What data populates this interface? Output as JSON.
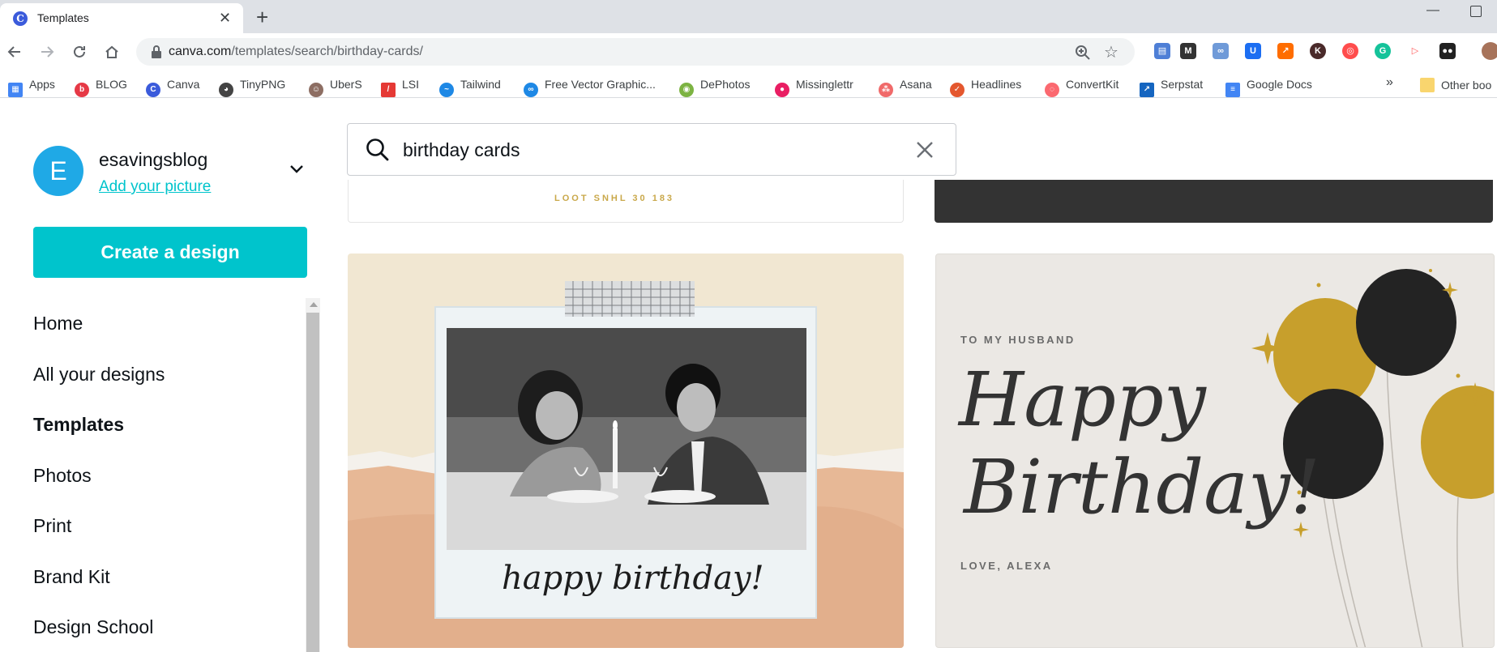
{
  "browser": {
    "tab_title": "Templates",
    "tab_favicon_letter": "C",
    "url_host": "canva.com",
    "url_path": "/templates/search/birthday-cards/",
    "icons": [
      "back-icon",
      "forward-icon",
      "reload-icon",
      "home-icon",
      "lock-icon",
      "zoom-icon",
      "star-icon"
    ]
  },
  "bookmarks": {
    "items": [
      {
        "label": "Apps",
        "color": "#ea4335"
      },
      {
        "label": "BLOG",
        "color": "#e63946"
      },
      {
        "label": "Canva",
        "color": "#3b5bdb"
      },
      {
        "label": "TinyPNG",
        "color": "#444444"
      },
      {
        "label": "UberS",
        "color": "#8d6e63"
      },
      {
        "label": "LSI",
        "color": "#e53935"
      },
      {
        "label": "Tailwind",
        "color": "#1e88e5"
      },
      {
        "label": "Free Vector Graphic...",
        "color": "#1e88e5"
      },
      {
        "label": "DePhotos",
        "color": "#7cb342"
      },
      {
        "label": "Missinglettr",
        "color": "#e91e63"
      },
      {
        "label": "Asana",
        "color": "#f06a6a"
      },
      {
        "label": "Headlines",
        "color": "#e4572e"
      },
      {
        "label": "ConvertKit",
        "color": "#fb6970"
      },
      {
        "label": "Serpstat",
        "color": "#1565c0"
      },
      {
        "label": "Google Docs",
        "color": "#4285f4"
      }
    ],
    "overflow": "»",
    "other_label": "Other boo"
  },
  "user": {
    "initial": "E",
    "name": "esavingsblog",
    "add_picture": "Add your picture"
  },
  "sidebar": {
    "create_label": "Create a design",
    "nav": [
      {
        "label": "Home",
        "active": false
      },
      {
        "label": "All your designs",
        "active": false
      },
      {
        "label": "Templates",
        "active": true
      },
      {
        "label": "Photos",
        "active": false
      },
      {
        "label": "Print",
        "active": false
      },
      {
        "label": "Brand Kit",
        "active": false
      },
      {
        "label": "Design School",
        "active": false
      }
    ]
  },
  "search": {
    "value": "birthday cards"
  },
  "cards": {
    "top_left_partial": "LOOT SNHL 30 183",
    "card1": {
      "text": "happy birthday!"
    },
    "card2": {
      "to": "TO MY HUSBAND",
      "happy": "Happy",
      "birthday": "Birthday!",
      "love": "LOVE, ALEXA"
    }
  },
  "colors": {
    "accent": "#00c4cc",
    "avatar": "#1fa9e6"
  }
}
